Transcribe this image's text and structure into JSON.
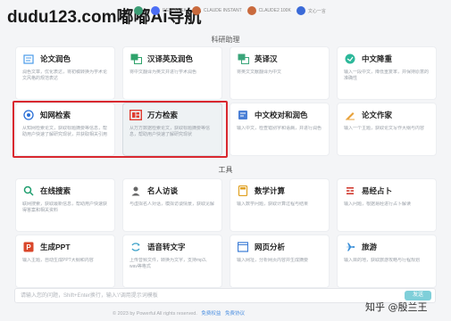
{
  "watermark": "dudu123.com嘟嘟Ai导航",
  "models": [
    {
      "name": "",
      "color": "#3b9c74"
    },
    {
      "name": "DEEPSEEK",
      "color": "#4c6ef5"
    },
    {
      "name": "CLAUDE INSTANT",
      "color": "#c96a3d"
    },
    {
      "name": "CLAUDE2 100K",
      "color": "#c96a3d"
    },
    {
      "name": "文心一言",
      "color": "#3a6ad8"
    }
  ],
  "sections": {
    "research": "科研助理",
    "tools": "工具"
  },
  "research_cards": [
    {
      "title": "论文润色",
      "icon": "doc-icon",
      "color": "#4a9be8",
      "desc": "润色文章，优化表达，将初稿转换为学术论文风格的规范表达"
    },
    {
      "title": "汉译英及润色",
      "icon": "translate-icon",
      "color": "#2fa36b",
      "desc": "将中文翻译为英文并进行学术润色"
    },
    {
      "title": "英译汉",
      "icon": "translate-en-icon",
      "color": "#3aa57a",
      "desc": "将英文文献翻译为中文"
    },
    {
      "title": "中文降重",
      "icon": "rewrite-icon",
      "color": "#2db89a",
      "desc": "输入一段中文，降低重复率，并保持原意的准确性"
    },
    {
      "title": "知网检索",
      "icon": "cnki-icon",
      "color": "#2a6fd6",
      "desc": "从知网检索论文，获取标题摘要等信息，帮助用户快速了解研究现状，并获取相关引用"
    },
    {
      "title": "万方检索",
      "icon": "wanfang-icon",
      "color": "#e03c31",
      "desc": "从万方数据检索论文，获取标题摘要等信息，帮助用户快速了解研究现状"
    },
    {
      "title": "中文校对和润色",
      "icon": "proofread-icon",
      "color": "#4a7fd6",
      "desc": "输入中文，检查错别字和语病，并进行润色"
    },
    {
      "title": "论文作家",
      "icon": "writer-icon",
      "color": "#e8a13a",
      "desc": "输入一个主题，获取论文写作大纲与内容"
    }
  ],
  "tool_cards": [
    {
      "title": "在线搜索",
      "icon": "search-icon",
      "color": "#1f9e6e",
      "desc": "联网搜索，获取最新信息，帮助用户快速获得答案和相关资料"
    },
    {
      "title": "名人访谈",
      "icon": "interview-icon",
      "color": "#666666",
      "desc": "与虚拟名人对话，模拟访谈情景，获取见解"
    },
    {
      "title": "数学计算",
      "icon": "calculator-icon",
      "color": "#e0a020",
      "desc": "输入数学问题，获取计算过程与结果"
    },
    {
      "title": "易经占卜",
      "icon": "divination-icon",
      "color": "#d03a2f",
      "desc": "输入问题，根据易经进行占卜解读"
    },
    {
      "title": "生成PPT",
      "icon": "ppt-icon",
      "color": "#d9472b",
      "desc": "输入主题，自动生成PPT大纲和内容"
    },
    {
      "title": "语音转文字",
      "icon": "voice-icon",
      "color": "#3aa0c8",
      "desc": "上传音频文件，转换为文字，支持mp3、wav等格式"
    },
    {
      "title": "网页分析",
      "icon": "webpage-icon",
      "color": "#3a7bd5",
      "desc": "输入网址，分析网页内容并生成摘要"
    },
    {
      "title": "旅游",
      "icon": "plane-icon",
      "color": "#3a8fd8",
      "desc": "输入目的地，获取旅游攻略与行程规划"
    }
  ],
  "chat": {
    "placeholder": "请输入您的问题，Shift+Enter换行，输入'/'调用提示词模板",
    "send_label": "发送"
  },
  "footer": {
    "copyright": "© 2023 by Powerful All rights reserved.",
    "link1": "免费权益",
    "link2": "免费协议"
  },
  "zhihu": "知乎 @殷兰王"
}
